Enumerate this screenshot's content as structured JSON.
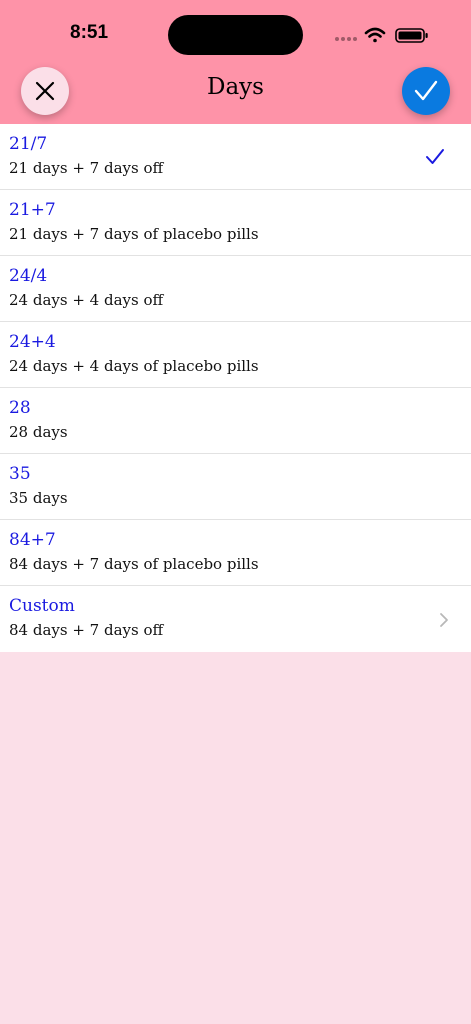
{
  "status_bar": {
    "time": "8:51"
  },
  "nav": {
    "title": "Days",
    "close_icon": "close-icon",
    "done_icon": "checkmark-icon"
  },
  "colors": {
    "header_bg": "#fe93a8",
    "page_bg": "#fbdfe8",
    "accent_blue": "#0a7ae0",
    "option_title": "#1a1ae0"
  },
  "options": [
    {
      "title": "21/7",
      "subtitle": "21 days + 7 days off",
      "selected": true
    },
    {
      "title": "21+7",
      "subtitle": "21 days + 7 days of placebo pills",
      "selected": false
    },
    {
      "title": "24/4",
      "subtitle": "24 days + 4 days off",
      "selected": false
    },
    {
      "title": "24+4",
      "subtitle": "24 days + 4 days of placebo pills",
      "selected": false
    },
    {
      "title": "28",
      "subtitle": "28 days",
      "selected": false
    },
    {
      "title": "35",
      "subtitle": "35 days",
      "selected": false
    },
    {
      "title": "84+7",
      "subtitle": "84 days + 7 days of placebo pills",
      "selected": false
    },
    {
      "title": "Custom",
      "subtitle": "84 days + 7 days off",
      "selected": false,
      "disclosure": true
    }
  ]
}
